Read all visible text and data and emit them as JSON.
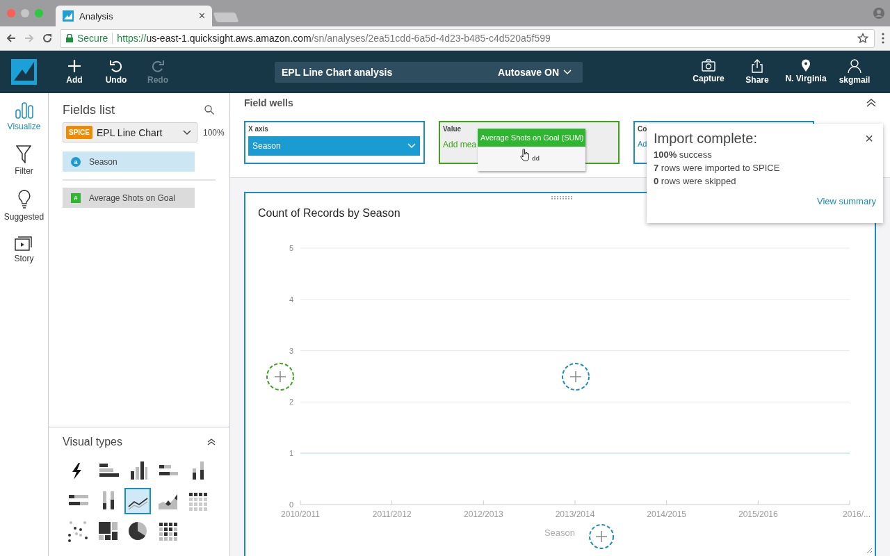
{
  "browser": {
    "tabs": [
      {
        "title": "Analysis",
        "selected": true,
        "close": "×"
      }
    ],
    "url": {
      "secure_label": "Secure",
      "scheme": "https://",
      "host": "us-east-1.quicksight.aws.amazon.com",
      "path": "/sn/analyses/2ea51cdd-6a5d-4d23-b485-c4d520a5f599"
    }
  },
  "toolbar": {
    "actions": [
      {
        "label": "Add",
        "kind": "add",
        "disabled": false
      },
      {
        "label": "Undo",
        "kind": "undo",
        "disabled": false
      },
      {
        "label": "Redo",
        "kind": "redo",
        "disabled": true
      }
    ],
    "analysis_title": "EPL Line Chart analysis",
    "autosave": "Autosave ON",
    "right_actions": [
      {
        "label": "Capture",
        "kind": "camera"
      },
      {
        "label": "Share",
        "kind": "share"
      },
      {
        "label": "N. Virginia",
        "kind": "pin"
      },
      {
        "label": "skgmail",
        "kind": "user"
      }
    ]
  },
  "rail": [
    {
      "label": "Visualize",
      "kind": "visualize",
      "selected": true
    },
    {
      "label": "Filter",
      "kind": "filter",
      "selected": false
    },
    {
      "label": "Suggested",
      "kind": "suggested",
      "selected": false
    },
    {
      "label": "Story",
      "kind": "story",
      "selected": false
    }
  ],
  "fields_panel": {
    "title": "Fields list",
    "dataset_badge": "SPICE",
    "dataset": "EPL Line Chart",
    "percent": "100%",
    "fields": [
      {
        "name": "Season",
        "kind": "dimension",
        "glyph": "a"
      },
      {
        "name": "Average Shots on Goal",
        "kind": "measure",
        "glyph": "#"
      }
    ]
  },
  "visual_types": {
    "title": "Visual types",
    "items": [
      {
        "kind": "autograph",
        "selected": false
      },
      {
        "kind": "bar_h",
        "selected": false
      },
      {
        "kind": "bar_v",
        "selected": false
      },
      {
        "kind": "stacked_h",
        "selected": false
      },
      {
        "kind": "stacked_v",
        "selected": false
      },
      {
        "kind": "stacked100_h",
        "selected": false
      },
      {
        "kind": "stacked100_v",
        "selected": false
      },
      {
        "kind": "line",
        "selected": true
      },
      {
        "kind": "area",
        "selected": false
      },
      {
        "kind": "pivot",
        "selected": false
      },
      {
        "kind": "scatter",
        "selected": false
      },
      {
        "kind": "treemap",
        "selected": false
      },
      {
        "kind": "pie",
        "selected": false
      },
      {
        "kind": "heatmap",
        "selected": false
      }
    ]
  },
  "field_wells": {
    "title": "Field wells",
    "wells": [
      {
        "label": "X axis",
        "kind": "filled",
        "value": "Season",
        "drop_target": false
      },
      {
        "label": "Value",
        "kind": "empty",
        "value": "Add mea",
        "drop_target": true
      },
      {
        "label": "Co",
        "kind": "empty",
        "value": "Ad",
        "drop_target": false
      }
    ]
  },
  "drag_ghost": {
    "label": "Average Shots on Goal (SUM)",
    "hint": "dd"
  },
  "visual": {
    "title": "Count of Records by Season",
    "chart_data": {
      "type": "line",
      "xlabel": "Season",
      "categories": [
        "2010/2011",
        "2011/2012",
        "2012/2013",
        "2013/2014",
        "2014/2015",
        "2015/2016",
        "2016/..."
      ],
      "series": [
        {
          "color": "#d3e9f5",
          "values": [
            1,
            1,
            1,
            1,
            1,
            1,
            1
          ]
        }
      ],
      "grid": true,
      "ylim": [
        0,
        5
      ],
      "yticks": [
        0,
        1,
        2,
        3,
        4,
        5
      ]
    },
    "drop_zones": [
      {
        "kind": "y_axis",
        "color": "#3ca31b"
      },
      {
        "kind": "center",
        "color": "#1a8db8"
      },
      {
        "kind": "x_axis",
        "color": "#1a8db8"
      }
    ]
  },
  "notification": {
    "title": "Import complete:",
    "close": "×",
    "lines": [
      "**100%** success",
      "**7** rows were imported to SPICE",
      "**0** rows were skipped"
    ],
    "link": "View summary"
  }
}
